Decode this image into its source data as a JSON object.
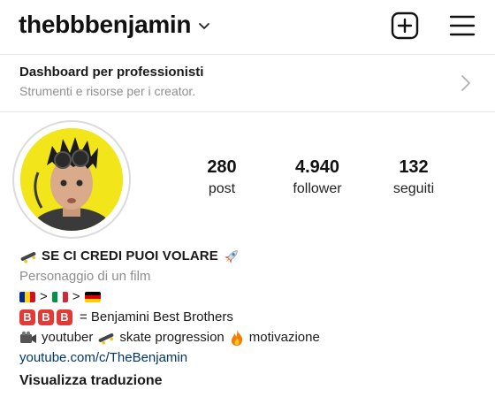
{
  "header": {
    "username": "thebbbenjamin"
  },
  "dashboard": {
    "title": "Dashboard per professionisti",
    "subtitle": "Strumenti e risorse per i creator."
  },
  "stats": {
    "posts": {
      "value": "280",
      "label": "post"
    },
    "followers": {
      "value": "4.940",
      "label": "follower"
    },
    "following": {
      "value": "132",
      "label": "seguiti"
    }
  },
  "bio": {
    "name": "SE CI CREDI PUOI VOLARE",
    "category": "Personaggio di un film",
    "flags_separator": ">",
    "badge_letter": "B",
    "brothers_text": "= Benjamini Best Brothers",
    "line5": {
      "youtuber": "youtuber",
      "skate": "skate progression",
      "motivation": "motivazione"
    },
    "link": "youtube.com/c/TheBenjamin",
    "translate": "Visualizza traduzione"
  },
  "icons": {
    "dropdown": "chevron-down-icon",
    "new_post": "plus-square-icon",
    "menu": "hamburger-menu-icon",
    "dashboard_arrow": "chevron-right-icon",
    "skateboard": "skateboard-icon",
    "rocket": "rocket-icon",
    "camera": "video-camera-icon",
    "fire": "fire-icon"
  },
  "colors": {
    "link": "#00376b",
    "muted": "#8e8e8e",
    "badge": "#e53935",
    "avatar_bg": "#f2e51a"
  }
}
